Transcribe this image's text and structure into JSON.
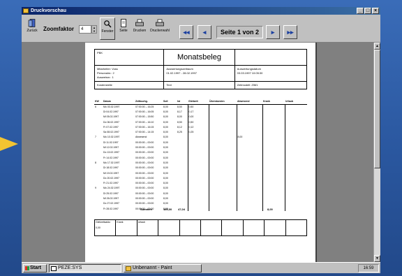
{
  "window": {
    "title": "Druckvorschau",
    "controls": [
      "_",
      "□",
      "×"
    ]
  },
  "toolbar": {
    "back_label": "Zurück",
    "zoom_label": "Zoomfaktor",
    "zoom_value": "4",
    "buttons": [
      "Fenster",
      "Seite",
      "Drucken",
      "Druckerwahl"
    ],
    "nav_first": "◂◂",
    "nav_prev": "◂",
    "nav_next": "▸",
    "nav_last": "▸▸",
    "page_indicator": "Seite 1 von 2"
  },
  "report": {
    "company": "PBK",
    "doc_title": "Monatsbeleg",
    "employee_label": "Mitarbeiter: Voss",
    "personnel_no": "Personalnr.: 2",
    "badge_no": "Ausweisnr.: 1",
    "period_label": "Auswertungszeitraum",
    "period_value": "01.02.1997 - 28.02.1997",
    "printdate_label": "Auswertungsdatum",
    "printdate_value": "03.03.1997 10:05:30",
    "cost_center": "Kostenstelle",
    "text_col": "Text",
    "time_model": "Zeitmodell: ZIM1",
    "columns": [
      "KW",
      "Datum",
      "Zeitbuchg.",
      "Soll",
      "Ist",
      "Gleitzeit",
      "Überstunden",
      "Abwesend",
      "Krank",
      "Urlaub"
    ],
    "rows": [
      [
        "6",
        "Mo 03.02.1997",
        "07:00:00 – 16:25",
        "8,00",
        "8,50",
        "0,50",
        "",
        "",
        "",
        ""
      ],
      [
        "",
        "Di 04.02.1997",
        "07:00:00 – 16:05",
        "8,00",
        "8,17",
        "0,17",
        "",
        "",
        "",
        ""
      ],
      [
        "",
        "Mi 05.02.1997",
        "07:00:00 – 15:50",
        "8,00",
        "8,00",
        "0,00",
        "",
        "",
        "",
        ""
      ],
      [
        "",
        "Do 06.02.1997",
        "07:00:00 – 16:10",
        "8,00",
        "8,50",
        "0,50",
        "",
        "",
        "",
        ""
      ],
      [
        "",
        "Fr 07.02.1997",
        "07:00:00 – 16:15",
        "8,00",
        "8,12",
        "0,12",
        "",
        "",
        "",
        ""
      ],
      [
        "",
        "Sa 08.02.1997",
        "07:00:00 – 14:15",
        "8,00",
        "8,25",
        "0,25",
        "",
        "",
        "",
        ""
      ],
      [
        "7",
        "Mo 10.02.1997",
        "Abwesend",
        "8,00",
        "",
        "",
        "",
        "8,00",
        "",
        ""
      ],
      [
        "",
        "Di 11.02.1997",
        "00:00:00 – 00:00",
        "8,00",
        "",
        "",
        "",
        "",
        "",
        ""
      ],
      [
        "",
        "Mi 12.02.1997",
        "00:00:00 – 00:00",
        "8,00",
        "",
        "",
        "",
        "",
        "",
        ""
      ],
      [
        "",
        "Do 13.02.1997",
        "00:00:00 – 00:00",
        "8,00",
        "",
        "",
        "",
        "",
        "",
        ""
      ],
      [
        "",
        "Fr 14.02.1997",
        "00:00:00 – 00:00",
        "8,00",
        "",
        "",
        "",
        "",
        "",
        ""
      ],
      [
        "8",
        "Mo 17.02.1997",
        "00:00:00 – 00:00",
        "8,00",
        "",
        "",
        "",
        "",
        "",
        ""
      ],
      [
        "",
        "Di 18.02.1997",
        "00:00:00 – 00:00",
        "8,00",
        "",
        "",
        "",
        "",
        "",
        ""
      ],
      [
        "",
        "Mi 19.02.1997",
        "00:00:00 – 00:00",
        "8,00",
        "",
        "",
        "",
        "",
        "",
        ""
      ],
      [
        "",
        "Do 20.02.1997",
        "00:00:00 – 00:00",
        "8,00",
        "",
        "",
        "",
        "",
        "",
        ""
      ],
      [
        "",
        "Fr 21.02.1997",
        "00:00:00 – 00:00",
        "8,00",
        "",
        "",
        "",
        "",
        "",
        ""
      ],
      [
        "9",
        "Mo 24.02.1997",
        "00:00:00 – 00:00",
        "8,00",
        "",
        "",
        "",
        "",
        "",
        ""
      ],
      [
        "",
        "Di 25.02.1997",
        "00:00:00 – 00:00",
        "8,00",
        "",
        "",
        "",
        "",
        "",
        ""
      ],
      [
        "",
        "Mi 26.02.1997",
        "00:00:00 – 00:00",
        "8,00",
        "",
        "",
        "",
        "",
        "",
        ""
      ],
      [
        "",
        "Do 27.02.1997",
        "00:00:00 – 00:00",
        "8,00",
        "",
        "",
        "",
        "",
        "",
        ""
      ],
      [
        "",
        "Fr 28.02.1997",
        "00:00:00 – 00:00",
        "8,00",
        "",
        "",
        "",
        "",
        "",
        ""
      ]
    ],
    "sum_label": "Summen",
    "sum_soll": "160,00",
    "sum_ist": "47,04",
    "sum_abw": "8,00",
    "footer_cols": [
      "Gleitzeitsaldo",
      "Krank",
      "Urlaub",
      "",
      "",
      "",
      "",
      "",
      "",
      ""
    ],
    "footer_value": "0,00"
  },
  "taskbar": {
    "start": "Start",
    "tasks": [
      "PEZE:SYS",
      "Unbenannt - Paint"
    ],
    "clock": "16:59"
  }
}
